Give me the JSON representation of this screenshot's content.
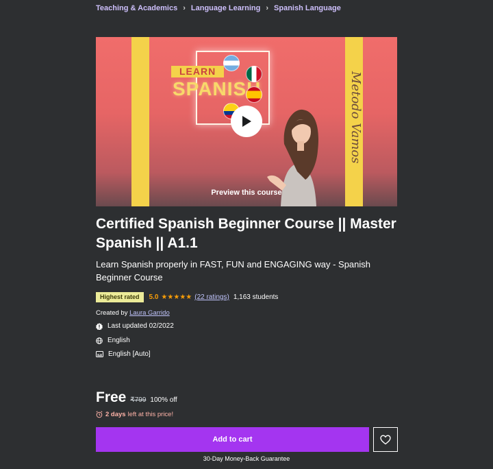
{
  "breadcrumb": {
    "items": [
      "Teaching & Academics",
      "Language Learning",
      "Spanish Language"
    ],
    "separator": "›"
  },
  "preview": {
    "label": "Preview this course",
    "thumbnail_learn": "LEARN",
    "thumbnail_spanish": "SPANISH",
    "thumbnail_side_text": "Metodo Vamos",
    "play_icon": "play-icon"
  },
  "course": {
    "title": "Certified Spanish Beginner Course || Master Spanish || A1.1",
    "subtitle": "Learn Spanish properly in FAST, FUN and ENGAGING way - Spanish Beginner Course"
  },
  "rating": {
    "badge": "Highest rated",
    "score": "5.0",
    "stars": 5,
    "stars_text": "★★★★★",
    "ratings_link": "(22 ratings)",
    "students": "1,163 students"
  },
  "instructor": {
    "prefix": "Created by",
    "name": "Laura Garrido"
  },
  "meta": {
    "last_updated": "Last updated 02/2022",
    "language": "English",
    "captions": "English [Auto]"
  },
  "pricing": {
    "current": "Free",
    "original": "₹799",
    "discount": "100% off",
    "timer_bold": "2 days",
    "timer_rest": "left at this price!"
  },
  "actions": {
    "add_to_cart": "Add to cart",
    "guarantee": "30-Day Money-Back Guarantee"
  },
  "colors": {
    "background": "#2d2f31",
    "accent": "#a435f0",
    "link": "#c0c4fc",
    "star": "#f69c08",
    "badge": "#eceb98"
  }
}
